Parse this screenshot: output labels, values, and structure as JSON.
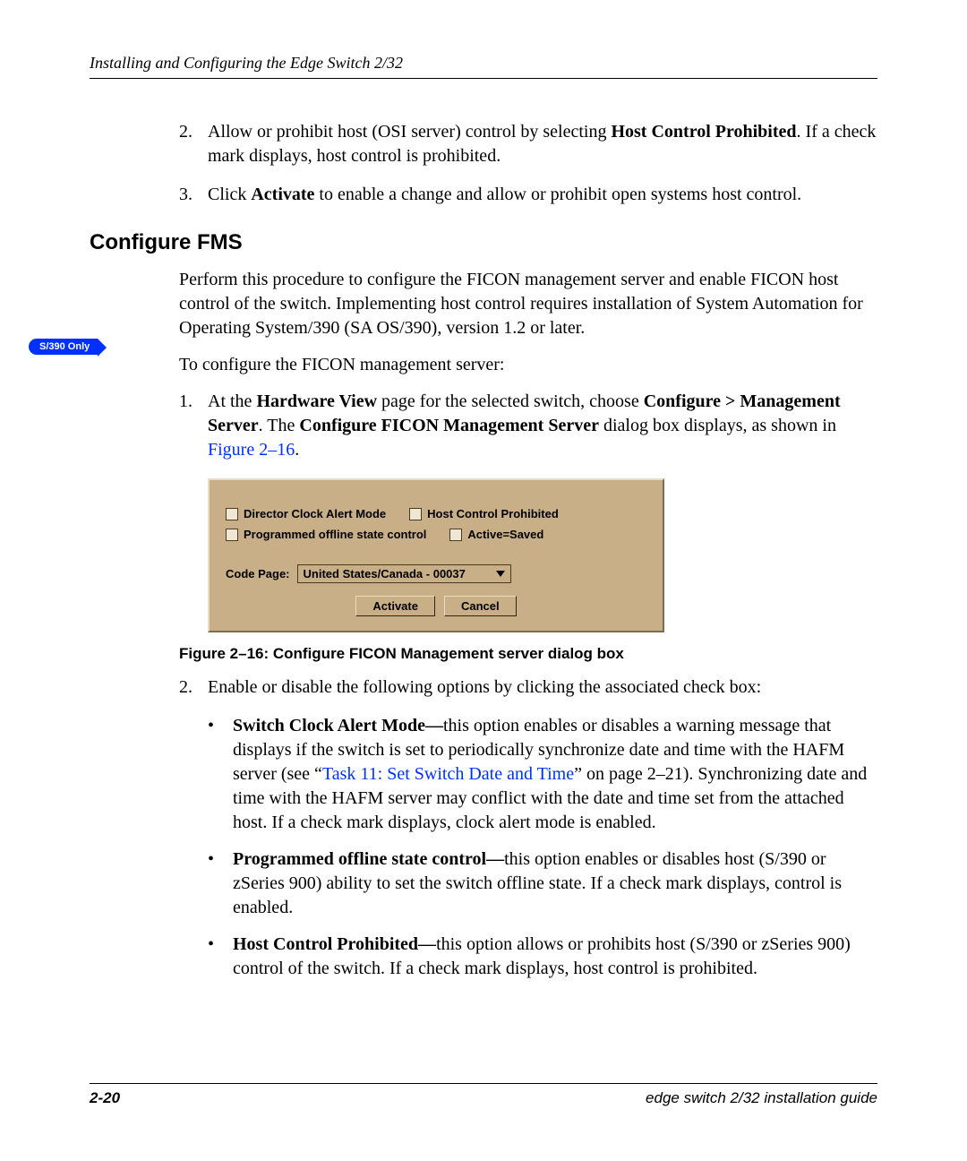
{
  "header": {
    "running": "Installing and Configuring the Edge Switch 2/32"
  },
  "margin_badge": "S/390 Only",
  "steps_a": {
    "n2": "2.",
    "t2_pre": "Allow or prohibit host (OSI server) control by selecting ",
    "t2_bold": "Host Control Prohibited",
    "t2_post": ". If a check mark displays, host control is prohibited.",
    "n3": "3.",
    "t3_pre": "Click ",
    "t3_bold": "Activate",
    "t3_post": " to enable a change and allow or prohibit open systems host control."
  },
  "h2": "Configure FMS",
  "intro": "Perform this procedure to configure the FICON management server and enable FICON host control of the switch. Implementing host control requires installation of System Automation for Operating System/390 (SA OS/390), version 1.2 or later.",
  "lead": "To configure the FICON management server:",
  "steps_b": {
    "n1": "1.",
    "t1_a": "At the ",
    "t1_b": "Hardware View",
    "t1_c": " page for the selected switch, choose ",
    "t1_d": "Configure > Management Server",
    "t1_e": ". The ",
    "t1_f": "Configure FICON Management Server",
    "t1_g": " dialog box displays, as shown in ",
    "t1_link": "Figure 2–16",
    "t1_h": ".",
    "n2": "2.",
    "t2": "Enable or disable the following options by clicking the associated check box:"
  },
  "dialog": {
    "chk1": "Director Clock Alert Mode",
    "chk2": "Host Control Prohibited",
    "chk3": "Programmed offline state control",
    "chk4": "Active=Saved",
    "codepage_label": "Code Page:",
    "codepage_value": "United States/Canada - 00037",
    "btn_activate": "Activate",
    "btn_cancel": "Cancel"
  },
  "figure_caption": "Figure 2–16:  Configure FICON Management server dialog box",
  "bullets": {
    "b1_lead": "Switch Clock Alert Mode—",
    "b1_a": "this option enables or disables a warning message that displays if the switch is set to periodically synchronize date and time with the HAFM server (see “",
    "b1_link": "Task 11: Set Switch Date and Time",
    "b1_b": "” on page 2–21). Synchronizing date and time with the HAFM server may conflict with the date and time set from the attached host. If a check mark displays, clock alert mode is enabled.",
    "b2_lead": "Programmed offline state control—",
    "b2_a": "this option enables or disables host (S/390 or zSeries 900) ability to set the switch offline state. If a check mark displays, control is enabled.",
    "b3_lead": "Host Control Prohibited—",
    "b3_a": "this option allows or prohibits host (S/390 or zSeries 900) control of the switch. If a check mark displays, host control is prohibited."
  },
  "footer": {
    "page": "2-20",
    "title": "edge switch 2/32 installation guide"
  }
}
